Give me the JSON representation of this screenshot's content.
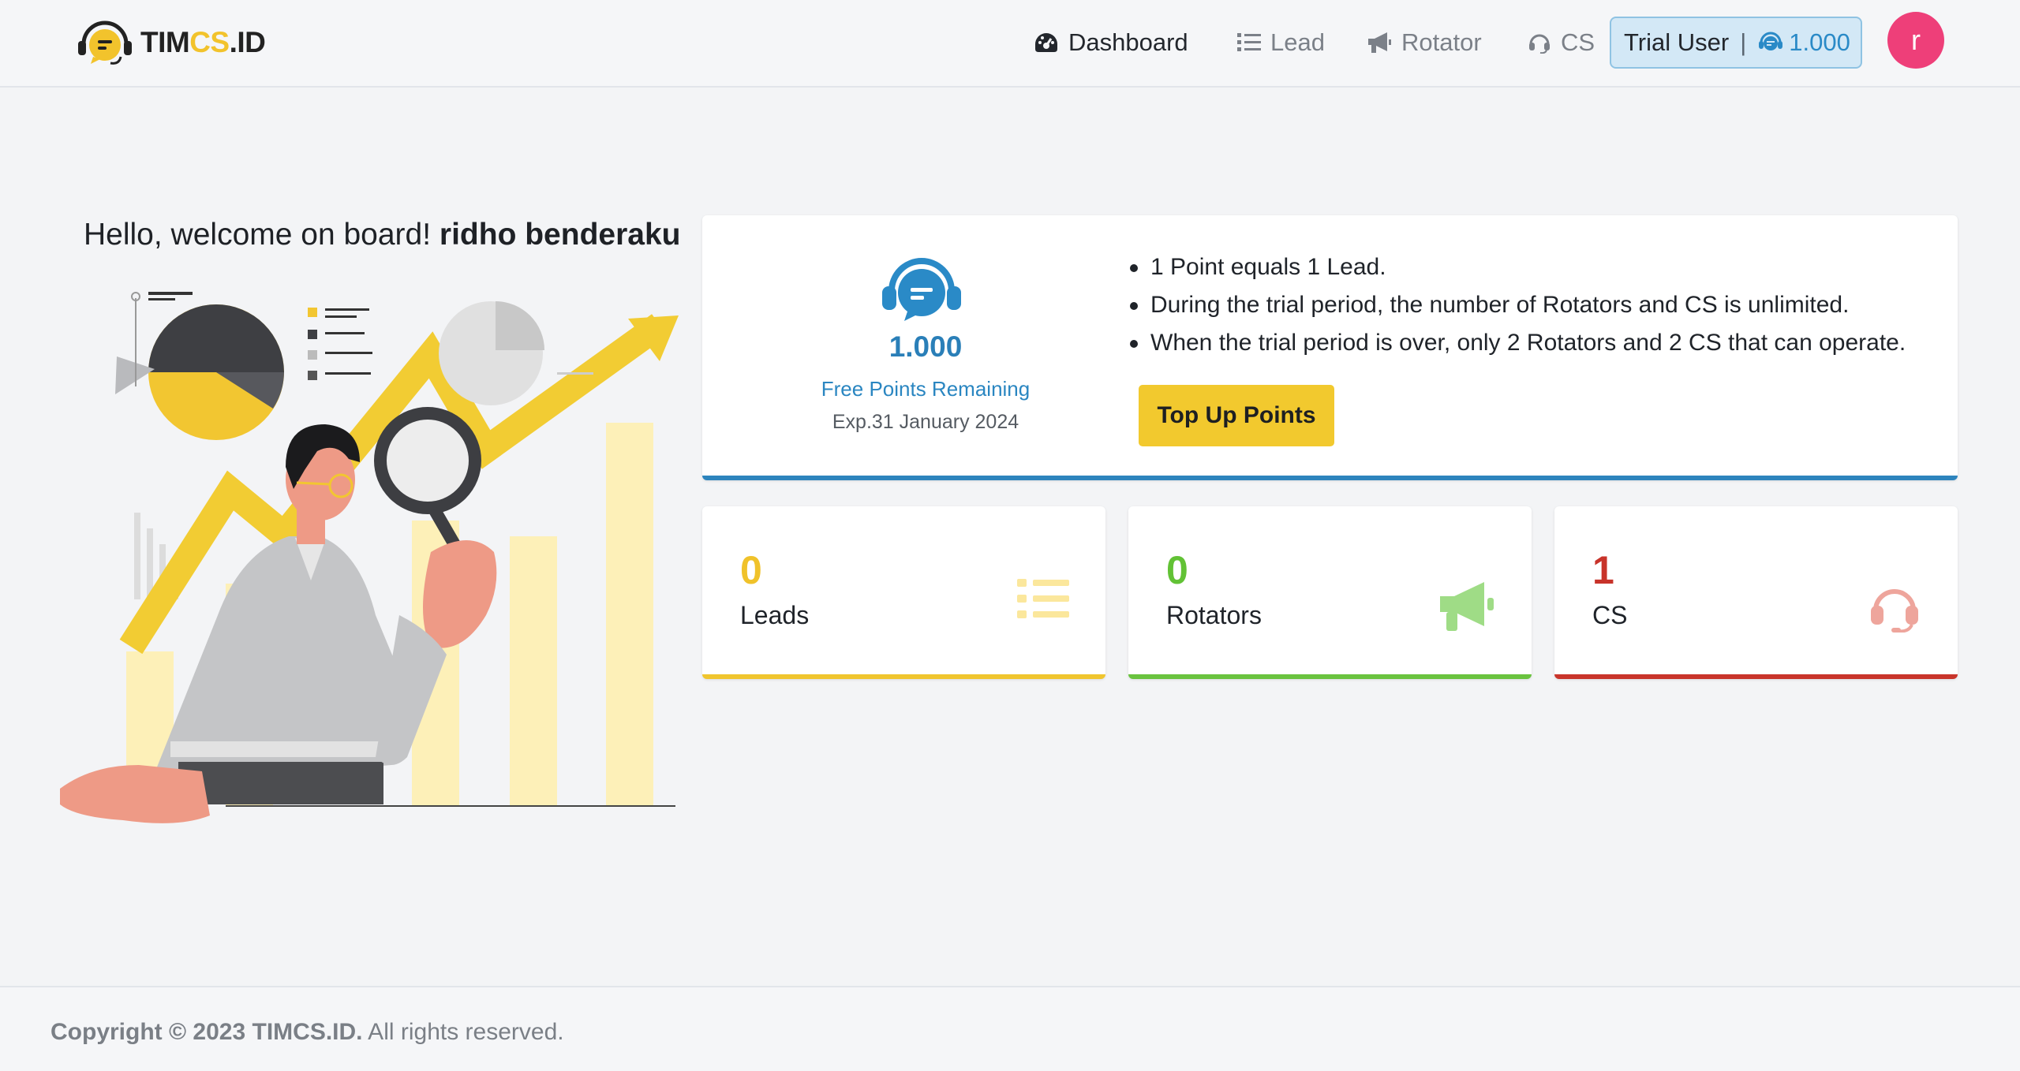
{
  "header": {
    "logo": {
      "part1": "TIM",
      "part2": "CS",
      "part3": ".ID"
    },
    "nav": [
      {
        "label": "Dashboard",
        "icon": "dashboard-gauge-icon",
        "active": true
      },
      {
        "label": "Lead",
        "icon": "list-icon",
        "active": false
      },
      {
        "label": "Rotator",
        "icon": "megaphone-icon",
        "active": false
      },
      {
        "label": "CS",
        "icon": "headset-icon",
        "active": false
      }
    ],
    "trial": {
      "label": "Trial User",
      "separator": "|",
      "points": "1.000"
    },
    "avatar_letter": "r"
  },
  "welcome": {
    "greeting": "Hello, welcome on board!",
    "user_name": "ridho benderaku"
  },
  "points_card": {
    "value": "1.000",
    "label": "Free Points Remaining",
    "expiry": "Exp.31 January 2024",
    "notes": [
      "1 Point equals 1 Lead.",
      "During the trial period, the number of Rotators and CS is unlimited.",
      "When the trial period is over, only 2 Rotators and 2 CS that can operate."
    ],
    "topup_label": "Top Up Points"
  },
  "stats": {
    "leads": {
      "value": "0",
      "label": "Leads"
    },
    "rotators": {
      "value": "0",
      "label": "Rotators"
    },
    "cs": {
      "value": "1",
      "label": "CS"
    }
  },
  "colors": {
    "accent_blue": "#2d84bd",
    "accent_yellow": "#f0c52e",
    "accent_green": "#6ac33f",
    "accent_red": "#c9352b",
    "avatar_pink": "#ee3f79"
  },
  "footer": {
    "brand": "Copyright © 2023 TIMCS.ID.",
    "rights": " All rights reserved."
  }
}
